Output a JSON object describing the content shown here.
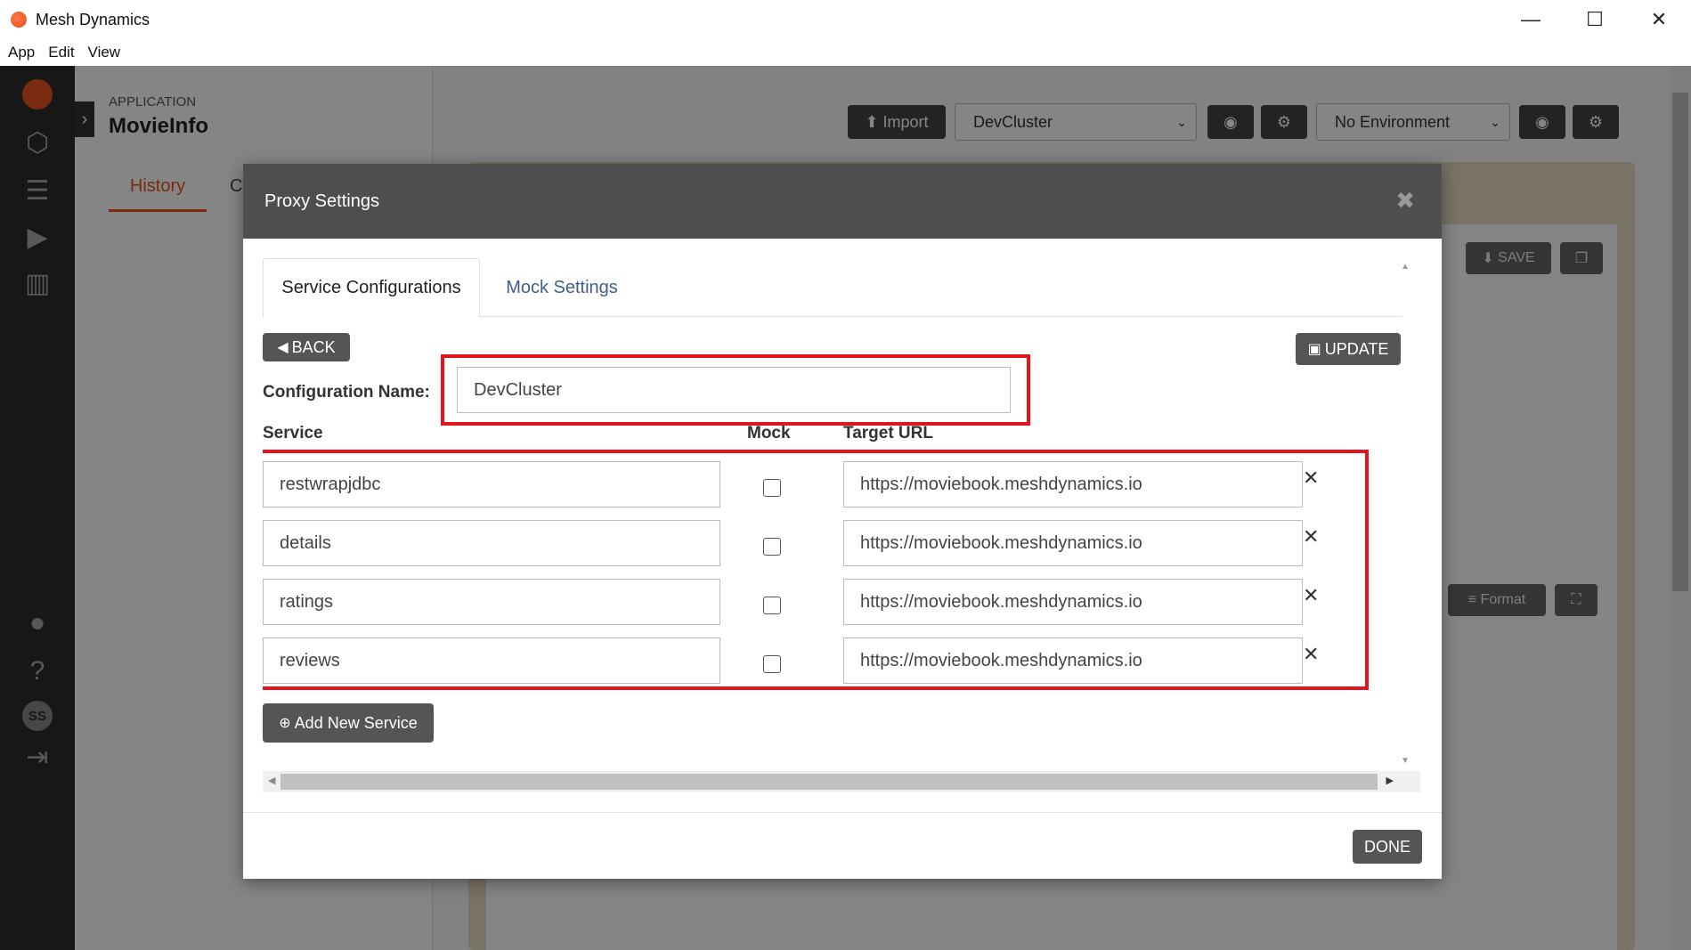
{
  "window": {
    "title": "Mesh Dynamics",
    "minimize": "—",
    "maximize": "☐",
    "close": "✕"
  },
  "menu": [
    "App",
    "Edit",
    "View"
  ],
  "sidebar": {
    "avatar": "SS"
  },
  "left_panel": {
    "app_label": "APPLICATION",
    "app_name": "MovieInfo",
    "tab_history": "History",
    "tab_partial": "C"
  },
  "top_bar": {
    "import_label": "Import",
    "cluster_value": "DevCluster",
    "environment_value": "No Environment"
  },
  "card": {
    "save_label": "SAVE",
    "format_label": "Format"
  },
  "modal": {
    "title": "Proxy Settings",
    "tabs": [
      "Service Configurations",
      "Mock Settings"
    ],
    "back_label": "BACK",
    "update_label": "UPDATE",
    "config_name_label": "Configuration Name:",
    "config_name_value": "DevCluster",
    "columns": {
      "service": "Service",
      "mock": "Mock",
      "target_url": "Target URL"
    },
    "services": [
      {
        "name": "restwrapjdbc",
        "mock": false,
        "url": "https://moviebook.meshdynamics.io"
      },
      {
        "name": "details",
        "mock": false,
        "url": "https://moviebook.meshdynamics.io"
      },
      {
        "name": "ratings",
        "mock": false,
        "url": "https://moviebook.meshdynamics.io"
      },
      {
        "name": "reviews",
        "mock": false,
        "url": "https://moviebook.meshdynamics.io"
      }
    ],
    "add_service_label": "Add New Service",
    "done_label": "DONE"
  },
  "colors": {
    "accent": "#e8531f",
    "highlight_border": "#e0161c",
    "dark_button": "#555555",
    "modal_header": "#4e4e4e"
  }
}
